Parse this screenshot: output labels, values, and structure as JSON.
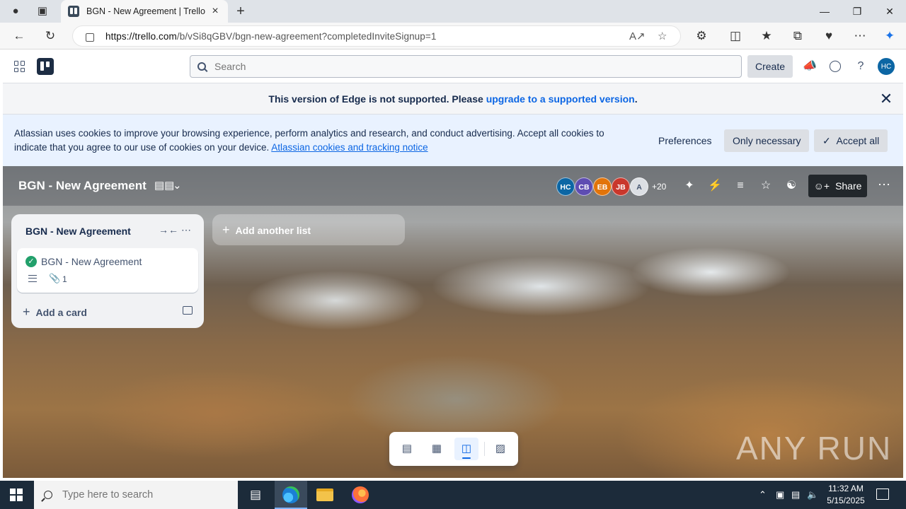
{
  "browser": {
    "tab_title": "BGN - New Agreement | Trello",
    "url_host": "https://trello.com",
    "url_path": "/b/vSi8qGBV/bgn-new-agreement?completedInviteSignup=1"
  },
  "header": {
    "search_placeholder": "Search",
    "create_label": "Create",
    "user_initials": "HC"
  },
  "edge_banner": {
    "text_before": "This version of Edge is not supported. Please ",
    "link_text": "upgrade to a supported version",
    "text_after": "."
  },
  "cookie_banner": {
    "text": "Atlassian uses cookies to improve your browsing experience, perform analytics and research, and conduct advertising. Accept all cookies to indicate that you agree to our use of cookies on your device. ",
    "link_text": "Atlassian cookies and tracking notice",
    "preferences_label": "Preferences",
    "only_necessary_label": "Only necessary",
    "accept_all_label": "Accept all"
  },
  "board": {
    "title": "BGN - New Agreement",
    "members": [
      {
        "initials": "HC",
        "color": "#0c66a4"
      },
      {
        "initials": "CB",
        "color": "#5e4db2"
      },
      {
        "initials": "EB",
        "color": "#e2740a"
      },
      {
        "initials": "JB",
        "color": "#c9372c"
      },
      {
        "initials": "A",
        "color": "#dcdfe4"
      }
    ],
    "members_more": "+20",
    "share_label": "Share",
    "lists": [
      {
        "title": "BGN - New Agreement",
        "cards": [
          {
            "title": "BGN - New Agreement",
            "attachments": "1"
          }
        ],
        "add_card_label": "Add a card"
      }
    ],
    "add_list_label": "Add another list"
  },
  "taskbar": {
    "search_placeholder": "Type here to search",
    "time": "11:32 AM",
    "date": "5/15/2025"
  },
  "watermark": "ANY RUN"
}
